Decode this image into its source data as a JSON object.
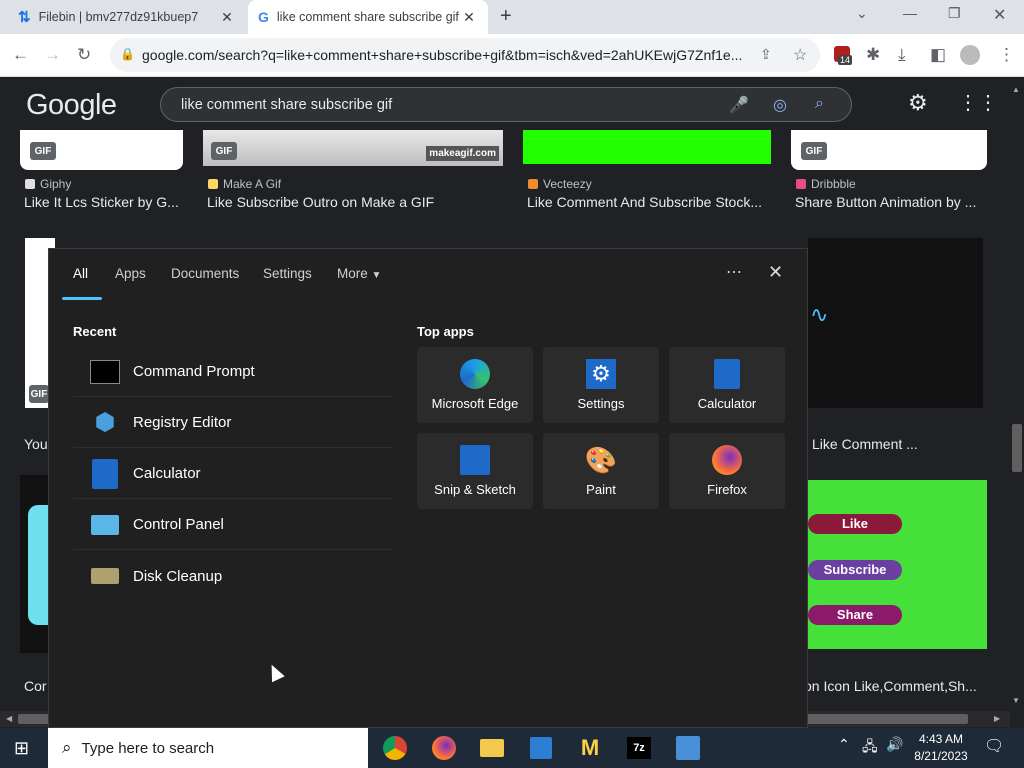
{
  "browser": {
    "tabs": [
      {
        "title": "Filebin | bmv277dz91kbuep7",
        "icon": "filebin-icon"
      },
      {
        "title": "like comment share subscribe gif",
        "icon": "google-icon"
      }
    ],
    "url": "google.com/search?q=like+comment+share+subscribe+gif&tbm=isch&ved=2ahUKEwjG7Znf1e...",
    "extension_badge": "14"
  },
  "google": {
    "logo": "Google",
    "query": "like comment share subscribe gif"
  },
  "results": [
    {
      "badge": "GIF",
      "source": "Giphy",
      "title": "Like It Lcs Sticker by G..."
    },
    {
      "badge": "GIF",
      "source": "Make A Gif",
      "title": "Like Subscribe Outro on Make a GIF",
      "watermark": "makeagif.com"
    },
    {
      "source": "Vecteezy",
      "title": "Like Comment And Subscribe Stock..."
    },
    {
      "badge": "GIF",
      "source": "Dribbble",
      "title": "Share Button Animation by ..."
    }
  ],
  "partial": {
    "row2_left_prefix": "You",
    "row2_right_title": "Like Comment ...",
    "row3_left_prefix": "Cor",
    "row3_right_title": "on Icon Like,Comment,Sh...",
    "gif_badge": "GIF",
    "buttons": [
      "Like",
      "Subscribe",
      "Share"
    ]
  },
  "start_menu": {
    "tabs": [
      "All",
      "Apps",
      "Documents",
      "Settings",
      "More"
    ],
    "recent_heading": "Recent",
    "recent": [
      {
        "label": "Command Prompt",
        "icon": "cmd-icon"
      },
      {
        "label": "Registry Editor",
        "icon": "regedit-icon"
      },
      {
        "label": "Calculator",
        "icon": "calculator-icon"
      },
      {
        "label": "Control Panel",
        "icon": "control-panel-icon"
      },
      {
        "label": "Disk Cleanup",
        "icon": "disk-cleanup-icon"
      }
    ],
    "top_apps_heading": "Top apps",
    "top_apps": [
      {
        "label": "Microsoft Edge",
        "icon": "edge-icon"
      },
      {
        "label": "Settings",
        "icon": "settings-icon"
      },
      {
        "label": "Calculator",
        "icon": "calculator-icon"
      },
      {
        "label": "Snip & Sketch",
        "icon": "snip-icon"
      },
      {
        "label": "Paint",
        "icon": "paint-icon"
      },
      {
        "label": "Firefox",
        "icon": "firefox-icon"
      }
    ]
  },
  "taskbar": {
    "search_placeholder": "Type here to search",
    "time": "4:43 AM",
    "date": "8/21/2023"
  },
  "colors": {
    "accent": "#4cc2ff",
    "google_bg": "#202124",
    "start_bg": "#202020",
    "taskbar_bg": "#1f2a38"
  }
}
